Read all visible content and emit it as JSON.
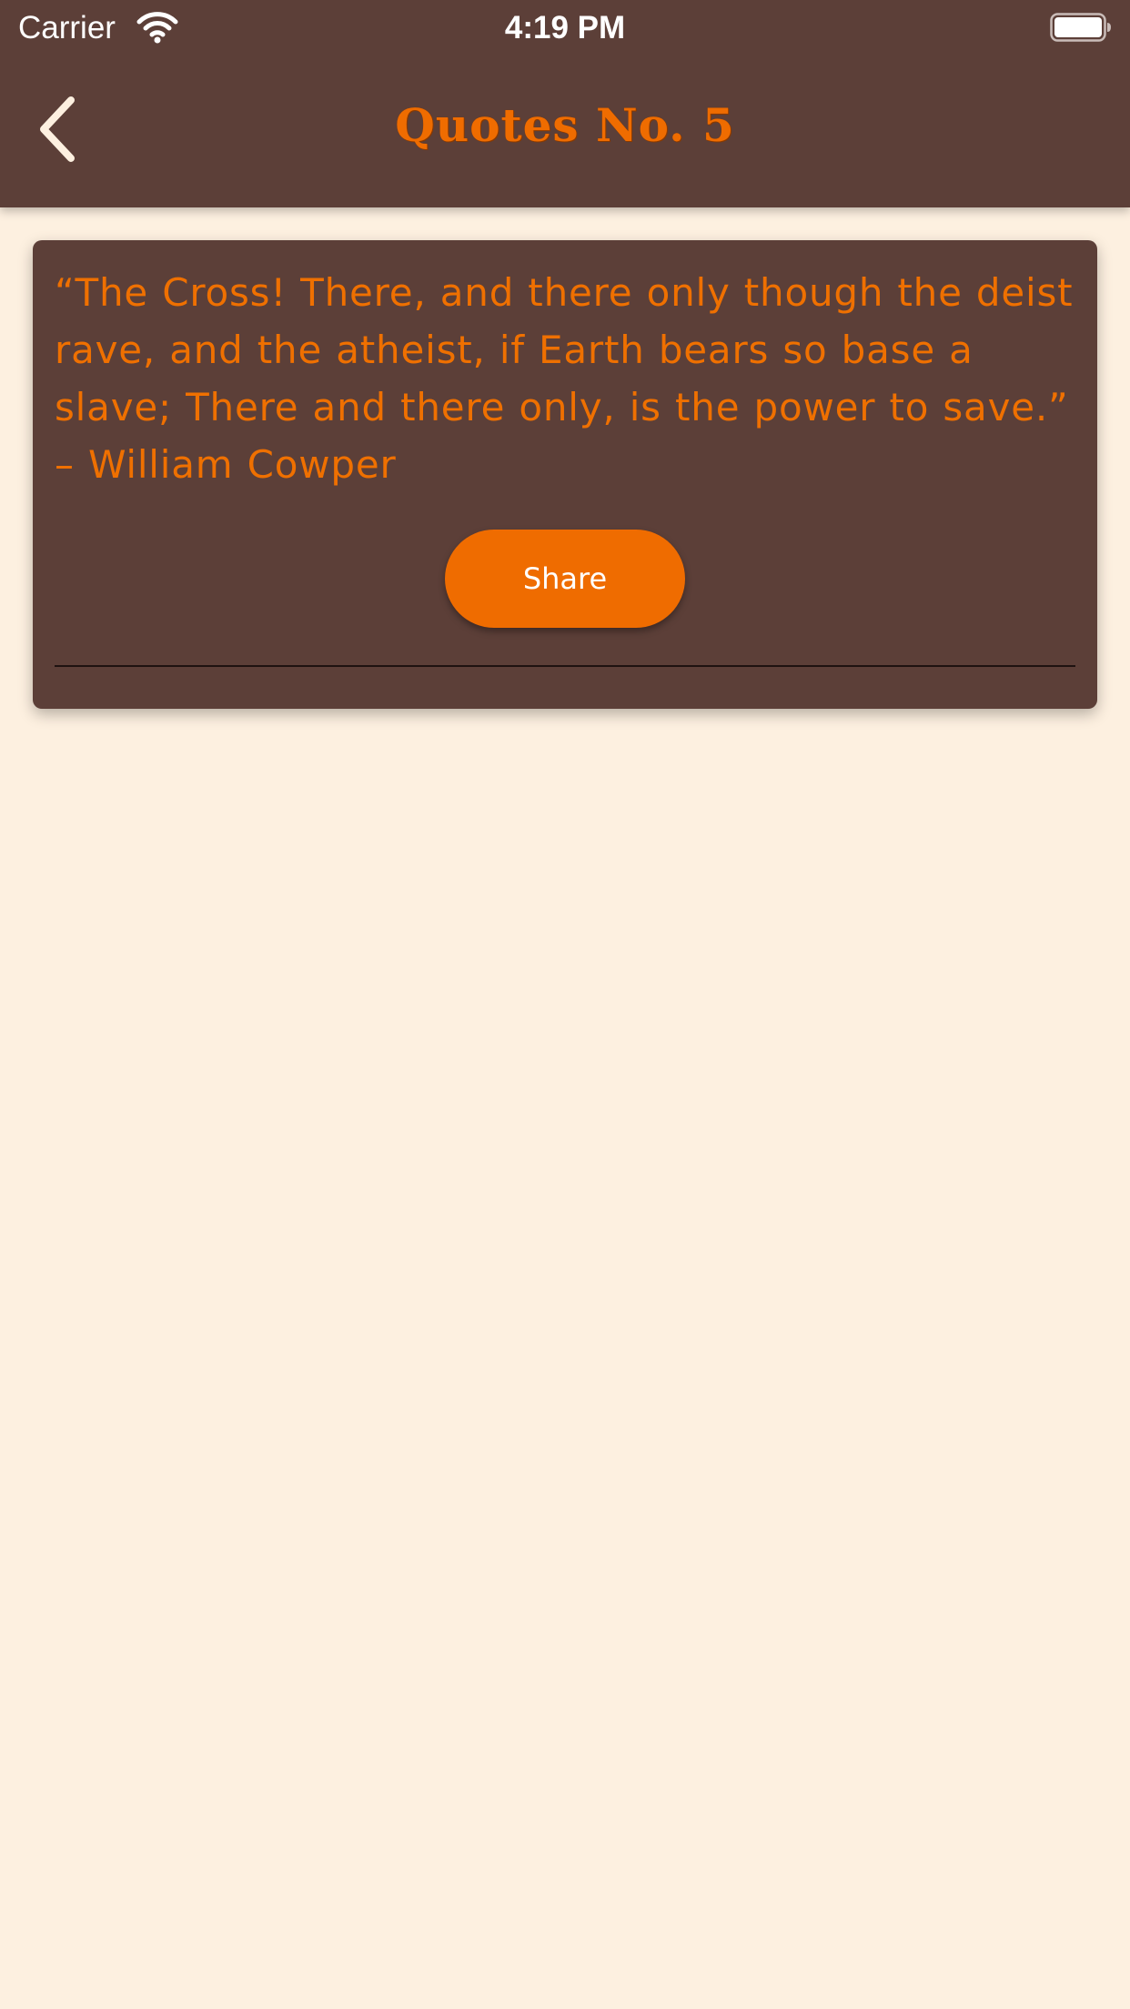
{
  "status_bar": {
    "carrier": "Carrier",
    "time": "4:19 PM",
    "wifi_icon": "wifi-icon",
    "battery_icon": "battery-full-icon",
    "battery_level_fraction": 1.0
  },
  "nav": {
    "title": "Quotes No. 5",
    "back_icon": "chevron-left-icon"
  },
  "quote": {
    "text": "“The Cross! There, and there only though the deist rave, and the atheist, if Earth bears so base a slave; There and there only, is the power to save.” – William Cowper",
    "share_label": "Share"
  },
  "colors": {
    "header_bg": "#5c3f38",
    "page_bg": "#fdf0e0",
    "accent": "#ef6c00",
    "card_bg": "#5c3f38",
    "status_text": "#ffffff"
  }
}
